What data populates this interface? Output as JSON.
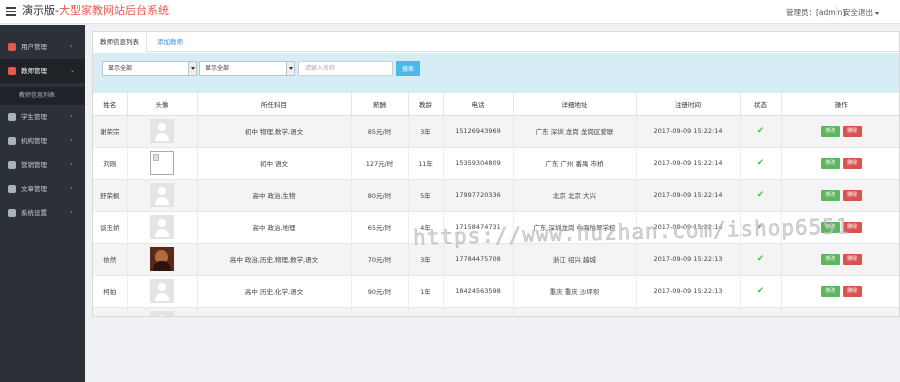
{
  "header": {
    "brand_prefix": "演示版-",
    "brand_suffix": "大型家教网站后台系统",
    "admin_label": "管理员：[admin]",
    "logout_label": "安全退出"
  },
  "sidebar": {
    "items": [
      {
        "label": "用户管理",
        "icon": "users-icon",
        "color": "#e8574b"
      },
      {
        "label": "教师管理",
        "icon": "teacher-icon",
        "color": "#e8574b"
      },
      {
        "label": "学生管理",
        "icon": "student-icon",
        "color": "#aab3bd"
      },
      {
        "label": "机构管理",
        "icon": "org-icon",
        "color": "#aab3bd"
      },
      {
        "label": "营销管理",
        "icon": "cloud-icon",
        "color": "#aab3bd"
      },
      {
        "label": "文章管理",
        "icon": "article-icon",
        "color": "#aab3bd"
      },
      {
        "label": "系统设置",
        "icon": "gear-icon",
        "color": "#aab3bd"
      }
    ],
    "sub_item": "教师信息列表"
  },
  "tabs": [
    "教师信息列表",
    "添加教师"
  ],
  "filter": {
    "select1": "显示全部",
    "select2": "显示全部",
    "search_placeholder": "请输入名称",
    "search_button": "搜索"
  },
  "table": {
    "columns": [
      "姓名",
      "头像",
      "所任科目",
      "薪酬",
      "教龄",
      "电话",
      "详细地址",
      "注册时间",
      "状态",
      "操作"
    ],
    "edit_label": "修改",
    "delete_label": "删除",
    "rows": [
      {
        "name": "谢荣宗",
        "avatar": "placeholder",
        "subjects": "初中 物理,数学,语文",
        "salary": "85元/时",
        "years": "3年",
        "phone": "15126943969",
        "address": "广东 深圳 龙岗 龙岗区爱联",
        "time": "2017-09-09 15:22:14"
      },
      {
        "name": "刘刚",
        "avatar": "broken",
        "subjects": "初中 语文",
        "salary": "127元/时",
        "years": "11年",
        "phone": "15359304809",
        "address": "广东 广州 番禺 市桥",
        "time": "2017-09-09 15:22:14"
      },
      {
        "name": "舒荣枫",
        "avatar": "placeholder",
        "subjects": "高中 政治,生物",
        "salary": "80元/时",
        "years": "5年",
        "phone": "17997720336",
        "address": "北京 北京 大兴",
        "time": "2017-09-09 15:22:14"
      },
      {
        "name": "谈玉娇",
        "avatar": "placeholder",
        "subjects": "高中 政治,地理",
        "salary": "65元/时",
        "years": "4年",
        "phone": "17158474731",
        "address": "广东 深圳龙岗 中海怡翠学校",
        "time": "2017-09-09 15:22:14"
      },
      {
        "name": "依然",
        "avatar": "photo",
        "subjects": "高中 政治,历史,物理,数学,语文",
        "salary": "70元/时",
        "years": "3年",
        "phone": "17784475708",
        "address": "浙江 绍兴 越城",
        "time": "2017-09-09 15:22:13"
      },
      {
        "name": "柯拍",
        "avatar": "placeholder",
        "subjects": "高中 历史,化学,语文",
        "salary": "90元/时",
        "years": "1年",
        "phone": "18424563598",
        "address": "重庆 重庆 沙坪坝",
        "time": "2017-09-09 15:22:13"
      },
      {
        "name": "",
        "avatar": "placeholder",
        "subjects": "",
        "salary": "",
        "years": "",
        "phone": "",
        "address": "",
        "time": ""
      }
    ]
  },
  "watermark": "https://www.huzhan.com/ishop6551"
}
